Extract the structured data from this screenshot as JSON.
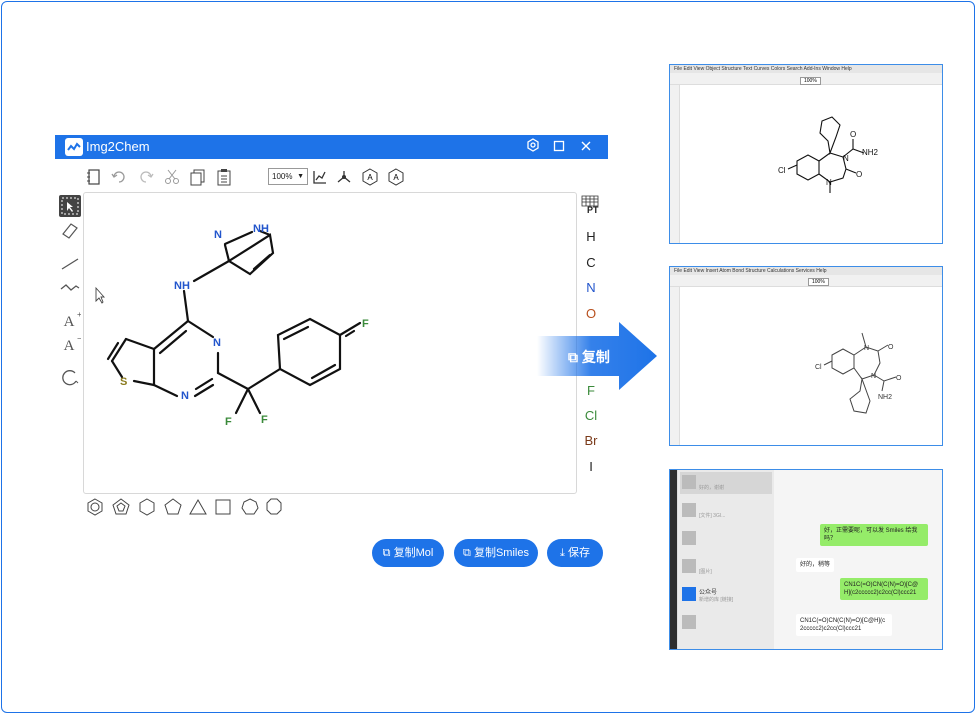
{
  "app": {
    "title": "Img2Chem",
    "zoom": "100%",
    "pt_label": "PT",
    "elements": [
      "H",
      "C",
      "N",
      "O",
      "F",
      "Cl",
      "Br",
      "I"
    ],
    "element_colors": [
      "#222222",
      "#222222",
      "#2255cc",
      "#b8501e",
      "#3a8a3a",
      "#3a8a3a",
      "#7a3a1a",
      "#222222"
    ],
    "buttons": {
      "copy_mol": "复制Mol",
      "copy_smiles": "复制Smiles",
      "save": "保存"
    },
    "molecule_labels": {
      "nh": "NH",
      "n1": "N",
      "hn": "NH",
      "n2": "N",
      "n3": "N",
      "s": "S",
      "f1": "F",
      "f2": "F",
      "f3": "F"
    }
  },
  "arrow": {
    "label": "复制"
  },
  "shot1": {
    "menu": "File  Edit  View  Object  Structure  Text  Curves  Colors  Search  Add-Ins  Window  Help",
    "zoom": "100%",
    "mol": {
      "cl": "Cl",
      "n1": "N",
      "n2": "N",
      "nh2": "NH2",
      "o1": "O",
      "o2": "O"
    }
  },
  "shot2": {
    "menu": "File  Edit  View  Insert  Atom  Bond  Structure  Calculations  Services  Help",
    "zoom": "100%",
    "mol": {
      "cl": "Cl",
      "n1": "N",
      "n2": "N",
      "nh2": "NH2",
      "o1": "O",
      "o2": "O"
    }
  },
  "shot3": {
    "contacts": [
      {
        "name": "",
        "snippet": "好的，谢谢"
      },
      {
        "name": "",
        "snippet": "[文件] 3GI..."
      },
      {
        "name": "",
        "snippet": ""
      },
      {
        "name": "",
        "snippet": "[图片]"
      },
      {
        "name": "公众号",
        "snippet": "新增的库 [链接]"
      },
      {
        "name": "",
        "snippet": ""
      }
    ],
    "messages": [
      {
        "side": "right",
        "text": "好，正需要呢，可以发 Smiles 给我吗？"
      },
      {
        "side": "left",
        "text": "好的，稍等"
      },
      {
        "side": "right",
        "text": "CN1C(=O)CN(C(N)=O)[C@H](c2ccccc2)c2cc(Cl)ccc21"
      },
      {
        "side": "left",
        "text": "CN1C(=O)CN(C(N)=O)[C@H](c2ccccc2)c2cc(Cl)ccc21"
      }
    ]
  }
}
